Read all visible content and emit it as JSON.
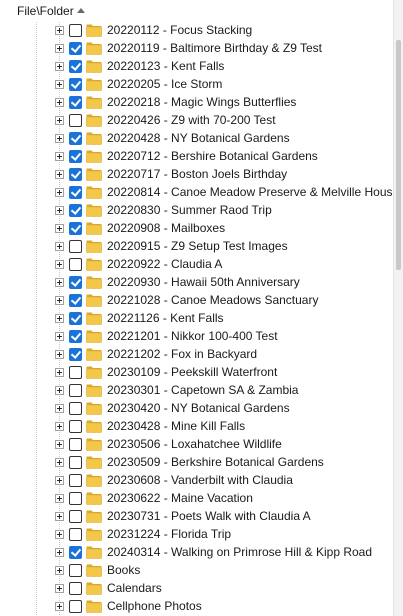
{
  "header": {
    "column_label": "File\\Folder",
    "sort_icon": "sort-ascending-icon"
  },
  "colors": {
    "check_blue": "#1a73d9",
    "folder_yellow": "#f3c74a",
    "folder_yellow_dark": "#dba928"
  },
  "rows": [
    {
      "label": "20220112 - Focus Stacking",
      "checked": false
    },
    {
      "label": "20220119 - Baltimore Birthday & Z9 Test",
      "checked": true
    },
    {
      "label": "20220123 - Kent Falls",
      "checked": true
    },
    {
      "label": "20220205 - Ice Storm",
      "checked": true
    },
    {
      "label": "20220218 - Magic Wings Butterflies",
      "checked": true
    },
    {
      "label": "20220426 - Z9 with 70-200 Test",
      "checked": false
    },
    {
      "label": "20220428 - NY Botanical Gardens",
      "checked": true
    },
    {
      "label": "20220712 - Bershire Botanical Gardens",
      "checked": true
    },
    {
      "label": "20220717 - Boston Joels Birthday",
      "checked": true
    },
    {
      "label": "20220814 - Canoe Meadow Preserve & Melville House",
      "checked": true
    },
    {
      "label": "20220830 - Summer Raod Trip",
      "checked": true
    },
    {
      "label": "20220908 - Mailboxes",
      "checked": true
    },
    {
      "label": "20220915 - Z9 Setup Test Images",
      "checked": false
    },
    {
      "label": "20220922 - Claudia A",
      "checked": false
    },
    {
      "label": "20220930 - Hawaii 50th Anniversary",
      "checked": true
    },
    {
      "label": "20221028 - Canoe Meadows Sanctuary",
      "checked": true
    },
    {
      "label": "20221126 - Kent Falls",
      "checked": true
    },
    {
      "label": "20221201 - Nikkor 100-400 Test",
      "checked": true
    },
    {
      "label": "20221202 - Fox in Backyard",
      "checked": true
    },
    {
      "label": "20230109 - Peekskill Waterfront",
      "checked": false
    },
    {
      "label": "20230301 - Capetown SA & Zambia",
      "checked": false
    },
    {
      "label": "20230420 - NY Botanical Gardens",
      "checked": false
    },
    {
      "label": "20230428 - Mine Kill Falls",
      "checked": false
    },
    {
      "label": "20230506 - Loxahatchee Wildlife",
      "checked": false
    },
    {
      "label": "20230509 - Berkshire Botanical Gardens",
      "checked": false
    },
    {
      "label": "20230608 - Vanderbilt with Claudia",
      "checked": false
    },
    {
      "label": "20230622 - Maine Vacation",
      "checked": false
    },
    {
      "label": "20230731 - Poets Walk with Claudia A",
      "checked": false
    },
    {
      "label": "20231224 - Florida Trip",
      "checked": false
    },
    {
      "label": "20240314 - Walking on Primrose Hill & Kipp Road",
      "checked": true
    },
    {
      "label": "Books",
      "checked": false
    },
    {
      "label": "Calendars",
      "checked": false
    },
    {
      "label": "Cellphone Photos",
      "checked": false
    }
  ]
}
